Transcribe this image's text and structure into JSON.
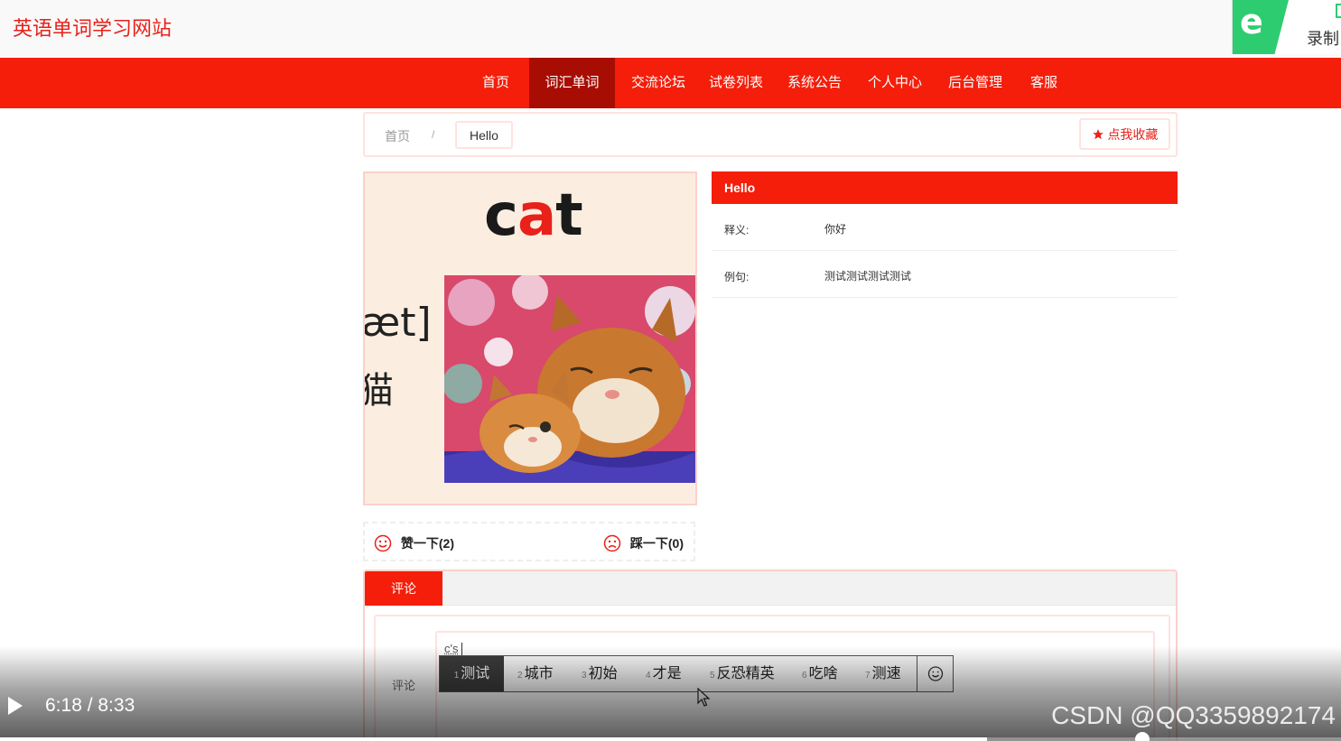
{
  "header": {
    "site_title": "英语单词学习网站",
    "recorder_label": "录制"
  },
  "nav": {
    "items": [
      {
        "label": "首页",
        "active": false
      },
      {
        "label": "词汇单词",
        "active": true
      },
      {
        "label": "交流论坛",
        "active": false
      },
      {
        "label": "试卷列表",
        "active": false
      },
      {
        "label": "系统公告",
        "active": false
      },
      {
        "label": "个人中心",
        "active": false
      },
      {
        "label": "后台管理",
        "active": false
      },
      {
        "label": "客服",
        "active": false
      }
    ]
  },
  "breadcrumb": {
    "home": "首页",
    "separator": "/",
    "current": "Hello",
    "favorite_label": "点我收藏"
  },
  "image": {
    "word_part1": "c",
    "word_part2": "a",
    "word_part3": "t",
    "phonetic": "æt]",
    "chinese": "猫"
  },
  "reactions": {
    "like_label": "赞一下(2)",
    "dislike_label": "踩一下(0)"
  },
  "detail": {
    "title": "Hello",
    "meaning_key": "释义:",
    "meaning_value": "你好",
    "example_key": "例句:",
    "example_value": "测试测试测试测试"
  },
  "comments": {
    "tab_label": "评论",
    "field_label": "评论",
    "input_text": "c's"
  },
  "ime": {
    "candidates": [
      {
        "num": "1",
        "text": "测试"
      },
      {
        "num": "2",
        "text": "城市"
      },
      {
        "num": "3",
        "text": "初始"
      },
      {
        "num": "4",
        "text": "才是"
      },
      {
        "num": "5",
        "text": "反恐精英"
      },
      {
        "num": "6",
        "text": "吃啥"
      },
      {
        "num": "7",
        "text": "测速"
      }
    ]
  },
  "video": {
    "time": "6:18 / 8:33",
    "progress": 0.736,
    "watermark": "CSDN @QQ3359892174"
  },
  "colors": {
    "brand_red": "#f41e0a",
    "active_nav": "#a80d03",
    "recorder_green": "#2ecc71"
  }
}
